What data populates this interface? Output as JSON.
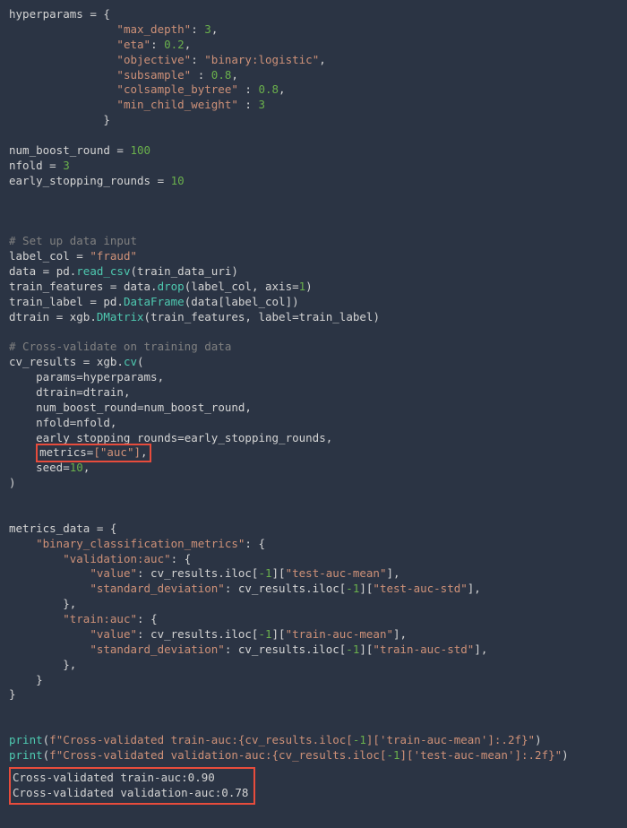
{
  "code": {
    "line1a": "hyperparams ",
    "line1b": " {",
    "hp_maxdepth_k": "\"max_depth\"",
    "hp_maxdepth_v": "3",
    "hp_eta_k": "\"eta\"",
    "hp_eta_v": "0.2",
    "hp_obj_k": "\"objective\"",
    "hp_obj_v": "\"binary:logistic\"",
    "hp_sub_k": "\"subsample\"",
    "hp_sub_v": "0.8",
    "hp_col_k": "\"colsample_bytree\"",
    "hp_col_v": "0.8",
    "hp_mcw_k": "\"min_child_weight\"",
    "hp_mcw_v": "3",
    "brace_close": "}",
    "nbr_l": "num_boost_round ",
    "nbr_v": "100",
    "nfold_l": "nfold ",
    "nfold_v": "3",
    "esr_l": "early_stopping_rounds ",
    "esr_v": "10",
    "comment1": "# Set up data input",
    "label_l": "label_col ",
    "label_v": "\"fraud\"",
    "data_l": "data ",
    "read_csv": "read_csv",
    "read_csv_arg": "(train_data_uri)",
    "tf_l": "train_features ",
    "drop": "drop",
    "drop_args_a": "(label_col, axis",
    "drop_args_b": ")",
    "one": "1",
    "tl_l": "train_label ",
    "dataframe": "DataFrame",
    "df_arg": "(data[label_col])",
    "dtr_l": "dtrain ",
    "dmatrix": "DMatrix",
    "dm_args": "(train_features, label",
    "dm_args2": "train_label)",
    "comment2": "# Cross-validate on training data",
    "cvr_l": "cv_results ",
    "cv": "cv",
    "cv_open": "(",
    "cv_params": "    params",
    "cv_params_v": "hyperparams,",
    "cv_dtrain": "    dtrain",
    "cv_dtrain_v": "dtrain,",
    "cv_nbr": "    num_boost_round",
    "cv_nbr_v": "num_boost_round,",
    "cv_nfold": "    nfold",
    "cv_nfold_v": "nfold,",
    "cv_esr": "    early_stopping_rounds",
    "cv_esr_v": "early_stopping_rounds,",
    "cv_metrics": "    metrics",
    "cv_metrics_v": "[\"auc\"]",
    "cv_metrics_comma": ",",
    "cv_seed": "    seed",
    "cv_seed_v": "10",
    "cv_close": ")",
    "md_l": "metrics_data ",
    "md_open": " {",
    "bcm_k": "\"binary_classification_metrics\"",
    "va_k": "\"validation:auc\"",
    "val_k": "\"value\"",
    "iloc_neg1": "-1",
    "tam": "\"test-auc-mean\"",
    "sd_k": "\"standard_deviation\"",
    "tas": "\"test-auc-std\"",
    "ta_k": "\"train:auc\"",
    "tram": "\"train-auc-mean\"",
    "tras": "\"train-auc-std\"",
    "print": "print",
    "fstr1a": "f\"Cross-validated train-auc:",
    "fstr1b": "{cv_results.iloc[",
    "fstr1c": "]['train-auc-mean']",
    "fstr1d": ":",
    "fstr1e": ".2f}",
    "fstr1f": "\"",
    "fstr2a": "f\"Cross-validated validation-auc:",
    "fstr2b": "{cv_results.iloc[",
    "fstr2c": "]['test-auc-mean']",
    "fstr2d": ":",
    "fstr2e": ".2f}",
    "fstr2f": "\"",
    "eq": "=",
    "pd": " pd.",
    "data_dot": " data.",
    "xgb": " xgb.",
    "comma": ",",
    "colon": ": ",
    "colon_nbsp": " : ",
    "iloc_pre": ": cv_results.iloc[",
    "iloc_post": "][",
    "iloc_end": "],",
    "closeb_comma": "},"
  },
  "output": {
    "line1": "Cross-validated train-auc:0.90",
    "line2": "Cross-validated validation-auc:0.78"
  }
}
